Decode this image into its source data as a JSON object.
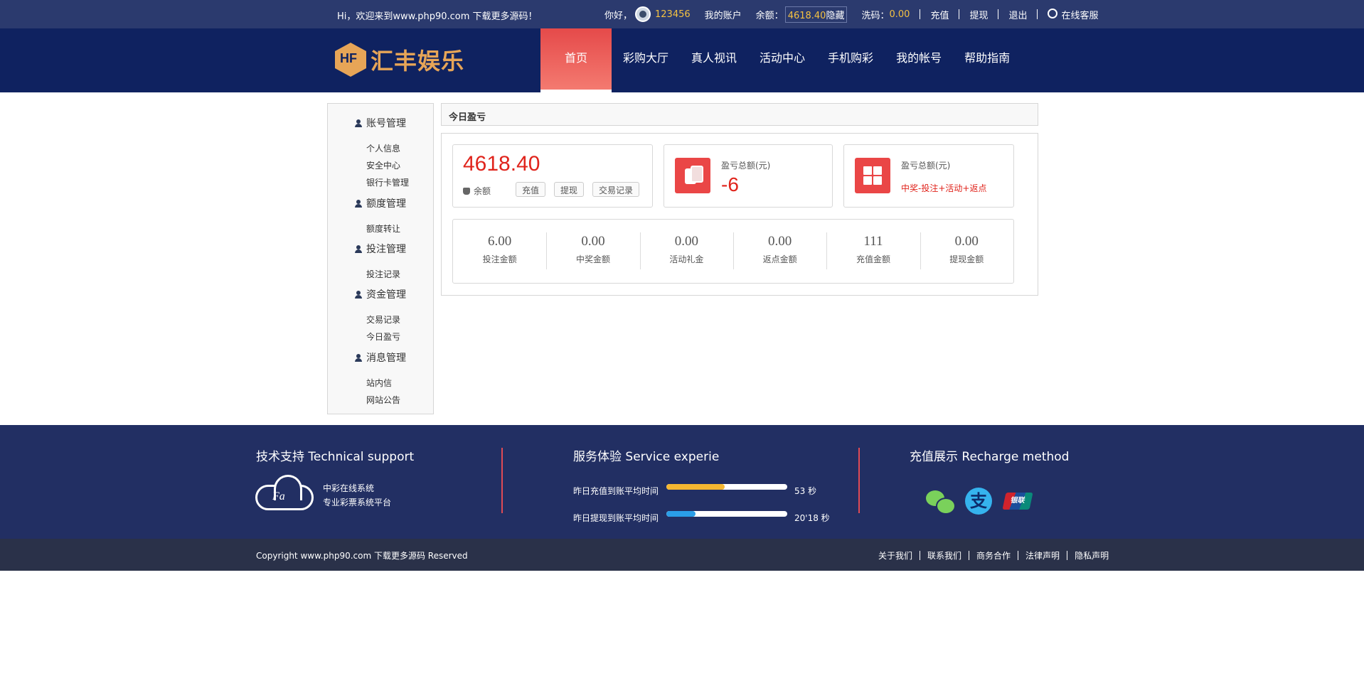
{
  "topbar": {
    "welcome": "Hi，欢迎来到www.php90.com 下载更多源码！",
    "greeting": "你好，",
    "username": "123456",
    "my_account": "我的账户",
    "balance_label": "余额：",
    "balance_value": "4618.40",
    "hide": "隐藏",
    "wash_label": "洗码：",
    "wash_value": "0.00",
    "recharge": "充值",
    "withdraw": "提现",
    "logout": "退出",
    "service": "在线客服"
  },
  "nav": {
    "logo_text": "汇丰娱乐",
    "items": [
      "首页",
      "彩购大厅",
      "真人视讯",
      "活动中心",
      "手机购彩",
      "我的帐号",
      "帮助指南"
    ],
    "active_index": 0
  },
  "sidebar": {
    "groups": [
      {
        "title": "账号管理",
        "items": [
          "个人信息",
          "安全中心",
          "银行卡管理"
        ]
      },
      {
        "title": "额度管理",
        "items": [
          "额度转让"
        ]
      },
      {
        "title": "投注管理",
        "items": [
          "投注记录"
        ]
      },
      {
        "title": "资金管理",
        "items": [
          "交易记录",
          "今日盈亏"
        ]
      },
      {
        "title": "消息管理",
        "items": [
          "站内信",
          "网站公告"
        ]
      }
    ]
  },
  "main": {
    "header": "今日盈亏",
    "balance_card": {
      "value": "4618.40",
      "label": "余额",
      "buttons": [
        "充值",
        "提现",
        "交易记录"
      ]
    },
    "profit_card": {
      "title": "盈亏总额(元)",
      "value": "-6"
    },
    "formula_card": {
      "title": "盈亏总额(元)",
      "desc": "中奖-投注+活动+返点"
    },
    "stats": [
      {
        "value": "6.00",
        "label": "投注金额"
      },
      {
        "value": "0.00",
        "label": "中奖金额"
      },
      {
        "value": "0.00",
        "label": "活动礼金"
      },
      {
        "value": "0.00",
        "label": "返点金额"
      },
      {
        "value": "111",
        "label": "充值金额"
      },
      {
        "value": "0.00",
        "label": "提现金额"
      }
    ]
  },
  "footer": {
    "support_title": "技术支持 Technical support",
    "support_logo": "Fa",
    "support_lines": [
      "中彩在线系统",
      "专业彩票系统平台"
    ],
    "service_title": "服务体验 Service experie",
    "service_rows": [
      {
        "label": "昨日充值到账平均时间",
        "value": "53 秒",
        "progress": 0.48,
        "color": "#f5b731"
      },
      {
        "label": "昨日提现到账平均时间",
        "value": "20'18 秒",
        "progress": 0.24,
        "color": "#2a9ee8"
      }
    ],
    "recharge_title": "充值展示 Recharge method",
    "alipay_glyph": "支",
    "unionpay_text": "银联"
  },
  "copyright": {
    "text": "Copyright www.php90.com 下载更多源码 Reserved",
    "links": [
      "关于我们",
      "联系我们",
      "商务合作",
      "法律声明",
      "隐私声明"
    ]
  }
}
